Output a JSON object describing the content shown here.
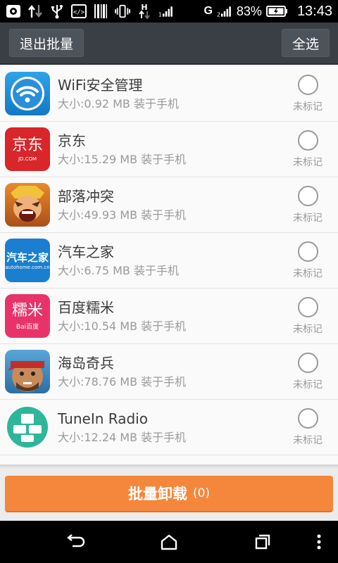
{
  "status_bar": {
    "battery_percent": "83%",
    "time": "13:43",
    "network_type": "G",
    "icons": [
      "settings-icon",
      "data-arrows-icon",
      "usb-icon",
      "debug-icon",
      "barcode-icon",
      "vibrate-icon",
      "hplus-icon",
      "signal-icon",
      "signal-icon",
      "battery-charging-icon"
    ]
  },
  "action_bar": {
    "exit_label": "退出批量",
    "select_all_label": "全选"
  },
  "apps": [
    {
      "name": "WiFi安全管理",
      "meta": "大小:0.92 MB 装于手机",
      "status": "未标记",
      "icon": "wifi-icon"
    },
    {
      "name": "京东",
      "meta": "大小:15.29 MB 装于手机",
      "status": "未标记",
      "icon": "jd-icon",
      "icon_text": "京东",
      "icon_sub": "JD.COM"
    },
    {
      "name": "部落冲突",
      "meta": "大小:49.93 MB 装于手机",
      "status": "未标记",
      "icon": "clash-icon"
    },
    {
      "name": "汽车之家",
      "meta": "大小:6.75 MB 装于手机",
      "status": "未标记",
      "icon": "autohome-icon",
      "icon_text": "汽车之家",
      "icon_sub": "autohome.com.cn"
    },
    {
      "name": "百度糯米",
      "meta": "大小:10.54 MB 装于手机",
      "status": "未标记",
      "icon": "nuomi-icon",
      "icon_text": "糯米",
      "icon_sub": "Bai百度"
    },
    {
      "name": "海岛奇兵",
      "meta": "大小:78.76 MB 装于手机",
      "status": "未标记",
      "icon": "boombeach-icon"
    },
    {
      "name": "TuneIn Radio",
      "meta": "大小:12.24 MB 装于手机",
      "status": "未标记",
      "icon": "tunein-icon"
    }
  ],
  "bottom": {
    "uninstall_label": "批量卸载",
    "uninstall_count": "(0)"
  },
  "colors": {
    "action_bar": "#3a3f46",
    "accent": "#f4873c"
  }
}
